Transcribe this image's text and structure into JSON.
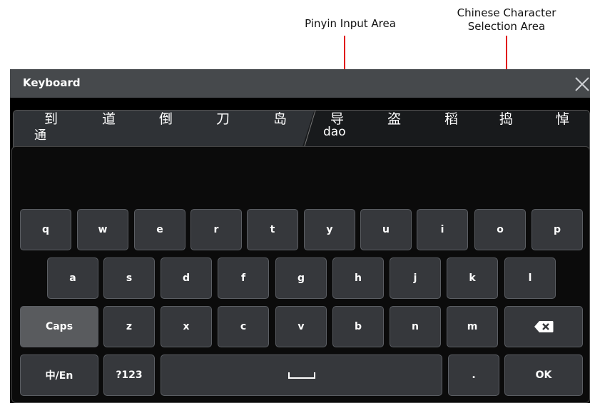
{
  "annotations": {
    "pinyin_area": "Pinyin Input Area",
    "char_area_line1": "Chinese Character",
    "char_area_line2": "Selection Area",
    "arrow_color": "#e11b1b"
  },
  "window": {
    "title": "Keyboard",
    "close_icon": "close-icon"
  },
  "input": {
    "committed_text": "通",
    "pinyin_text": "dao"
  },
  "candidates": [
    "到",
    "道",
    "倒",
    "刀",
    "岛",
    "导",
    "盗",
    "稻",
    "捣",
    "悼"
  ],
  "rows": {
    "row1": [
      "q",
      "w",
      "e",
      "r",
      "t",
      "y",
      "u",
      "i",
      "o",
      "p"
    ],
    "row2": [
      "a",
      "s",
      "d",
      "f",
      "g",
      "h",
      "j",
      "k",
      "l"
    ],
    "row3": {
      "caps": "Caps",
      "letters": [
        "z",
        "x",
        "c",
        "v",
        "b",
        "n",
        "m"
      ],
      "backspace_icon": "backspace-icon"
    },
    "row4": {
      "lang": "中/En",
      "symbols": "?123",
      "space_icon": "space-icon",
      "period": ".",
      "ok": "OK"
    }
  },
  "colors": {
    "key_bg": "#36383c",
    "caps_bg": "#595b5e",
    "titlebar_bg": "#46494c"
  }
}
